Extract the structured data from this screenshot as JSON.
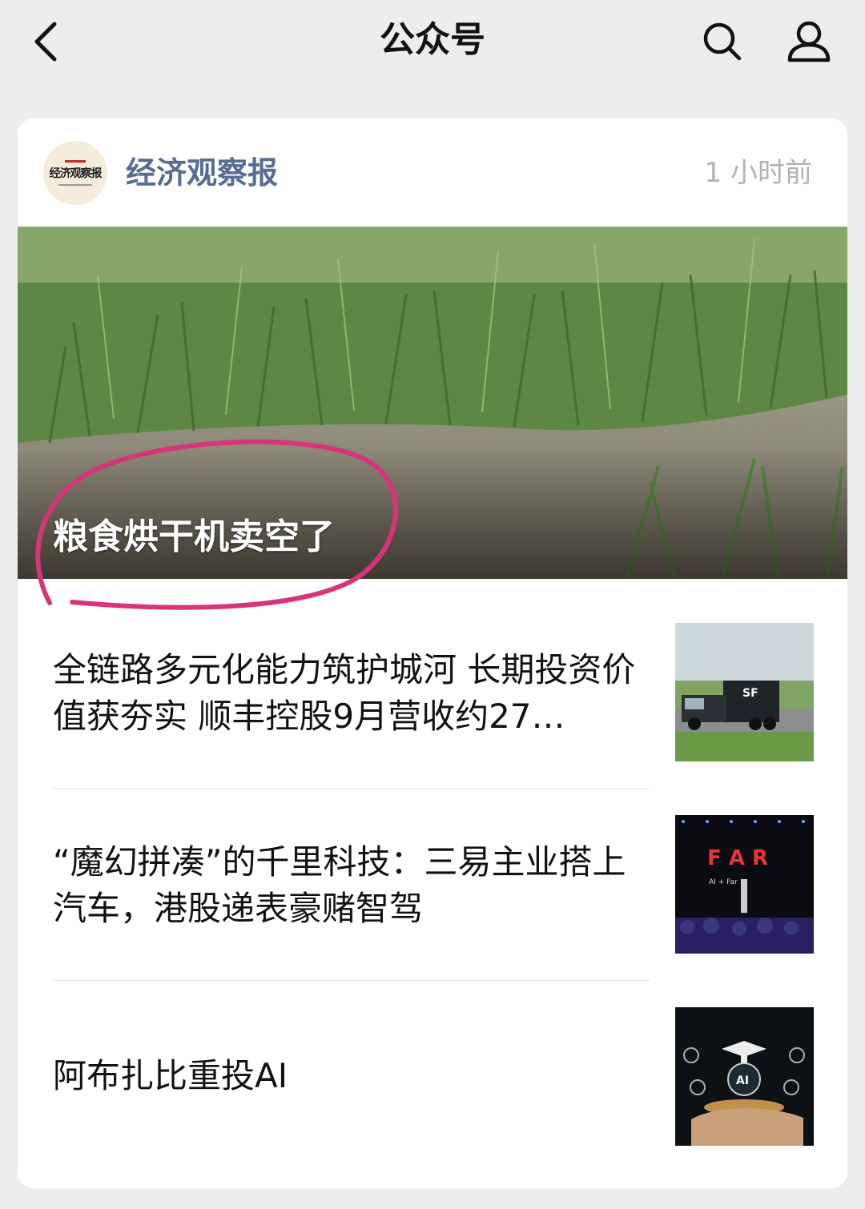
{
  "header": {
    "title": "公众号",
    "back_icon": "chevron-left-icon",
    "search_icon": "search-icon",
    "profile_icon": "person-icon"
  },
  "account": {
    "name": "经济观察报",
    "avatar_text": "经济观察报",
    "time": "1 小时前"
  },
  "hero": {
    "title": "粮食烘干机卖空了"
  },
  "articles": [
    {
      "title": "全链路多元化能力筑护城河 长期投资价值获夯实 顺丰控股9月营收约27…",
      "thumb": "truck-on-road"
    },
    {
      "title": "“魔幻拼凑”的千里科技：三易主业搭上汽车，港股递表豪赌智驾",
      "thumb": "far-stage-event"
    },
    {
      "title": "阿布扎比重投AI",
      "thumb": "ai-hand-graphic"
    }
  ],
  "thumb_texts": {
    "truck_logo": "SF",
    "stage_word": "F A R",
    "stage_sub": "AI + Far",
    "ai_label": "AI"
  },
  "colors": {
    "background": "#ededed",
    "account_name": "#576b95",
    "annotation": "#d8347a"
  }
}
